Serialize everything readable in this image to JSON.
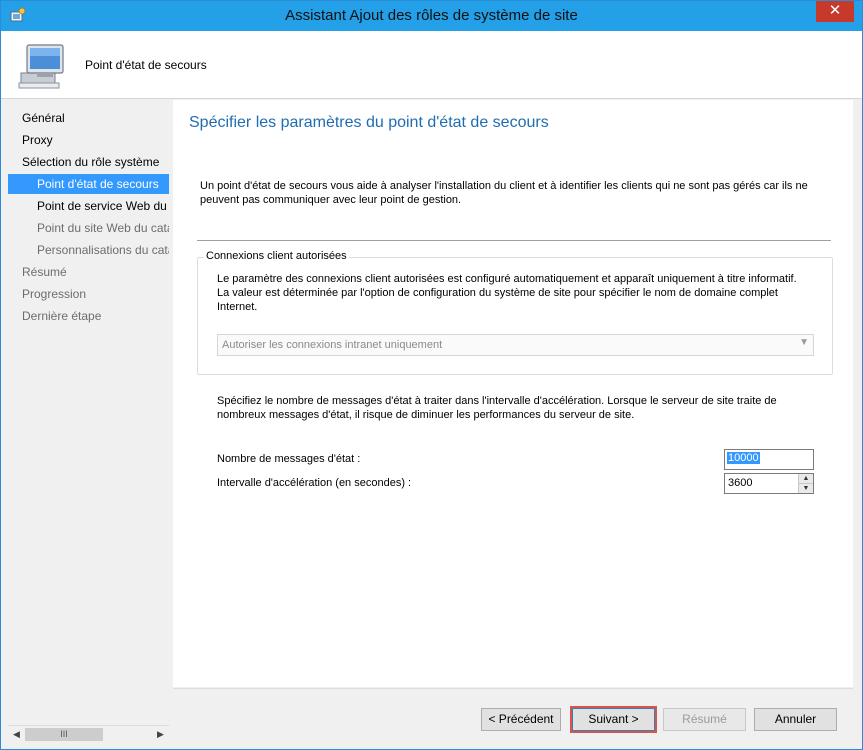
{
  "window": {
    "title": "Assistant Ajout des rôles de système de site",
    "close_glyph": "✕"
  },
  "header": {
    "title": "Point d'état de secours"
  },
  "nav": {
    "items": [
      {
        "label": "Général"
      },
      {
        "label": "Proxy"
      },
      {
        "label": "Sélection du rôle système"
      },
      {
        "label": "Point d'état de secours"
      },
      {
        "label": "Point de service Web du catalogue des applications"
      },
      {
        "label": "Point du site Web du catalogue des applications"
      },
      {
        "label": "Personnalisations du catalogue des applications"
      },
      {
        "label": "Résumé"
      },
      {
        "label": "Progression"
      },
      {
        "label": "Dernière étape"
      }
    ],
    "scroll_left": "◀",
    "scroll_thumb": "III",
    "scroll_right": "▶"
  },
  "main": {
    "title": "Spécifier les paramètres du point d'état de secours",
    "intro": "Un point d'état de secours vous aide à analyser l'installation du client et à identifier les clients qui ne sont pas gérés car ils ne peuvent pas communiquer avec leur point de gestion.",
    "group": {
      "legend": "Connexions client autorisées",
      "text": "Le paramètre des connexions client autorisées est configuré automatiquement et apparaît uniquement à titre informatif. La valeur est déterminée par l'option de configuration du système de site pour spécifier le nom de domaine complet Internet.",
      "combo_value": "Autoriser les connexions intranet uniquement"
    },
    "rate_text": "Spécifiez le nombre de messages d'état à traiter dans l'intervalle d'accélération. Lorsque le serveur de site traite de nombreux messages d'état, il risque de diminuer les performances du serveur de site.",
    "messages_label": "Nombre de messages d'état :",
    "messages_value": "10000",
    "interval_label": "Intervalle d'accélération (en secondes) :",
    "interval_value": "3600"
  },
  "buttons": {
    "previous": "< Précédent",
    "next": "Suivant >",
    "summary": "Résumé",
    "cancel": "Annuler"
  },
  "colors": {
    "titlebar": "#23a0e8",
    "selection": "#3399ff",
    "heading": "#1f6db2",
    "close": "#c7392a"
  }
}
